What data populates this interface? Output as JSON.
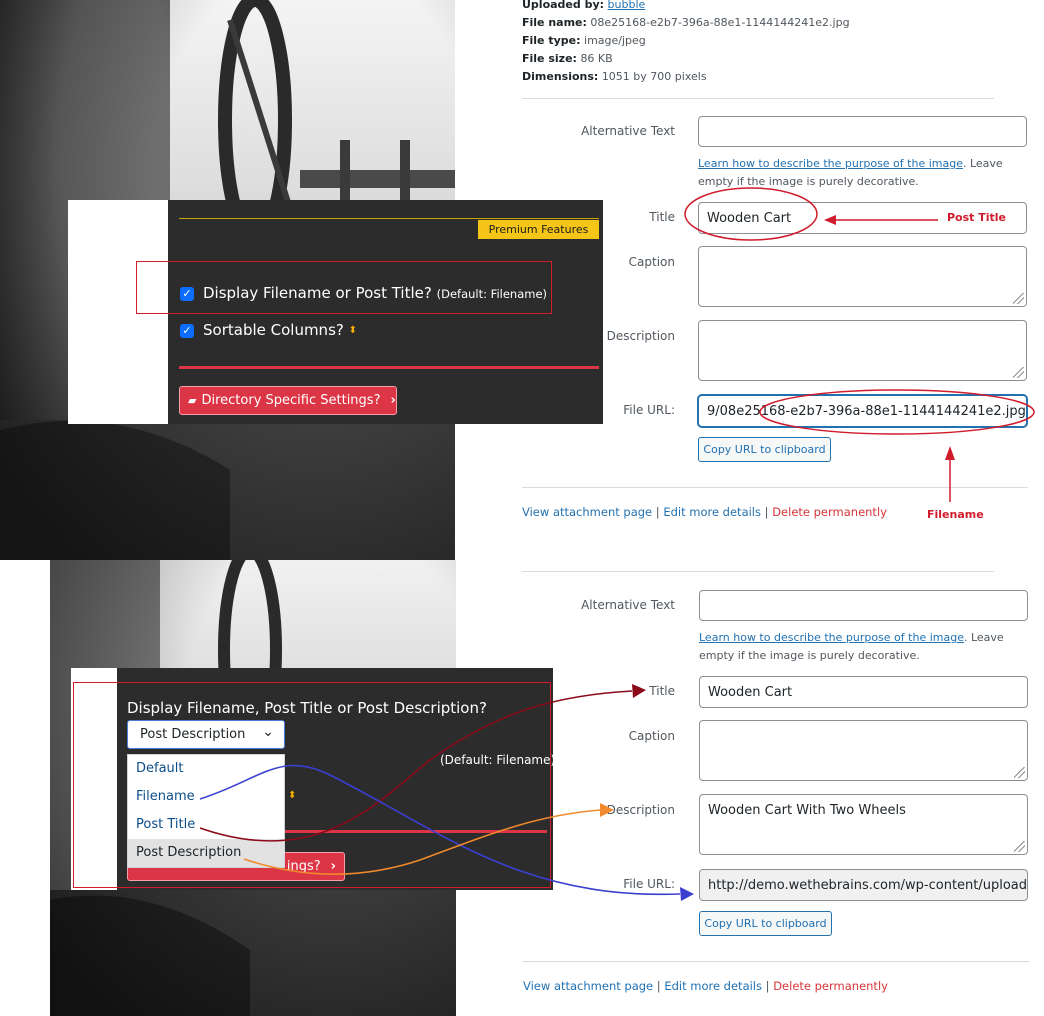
{
  "top": {
    "meta": {
      "uploaded_by_label": "Uploaded by:",
      "uploaded_by_value": "bubble",
      "file_name_label": "File name:",
      "file_name_value": "08e25168-e2b7-396a-88e1-1144144241e2.jpg",
      "file_type_label": "File type:",
      "file_type_value": "image/jpeg",
      "file_size_label": "File size:",
      "file_size_value": "86 KB",
      "dimensions_label": "Dimensions:",
      "dimensions_value": "1051 by 700 pixels"
    },
    "fields": {
      "alt_label": "Alternative Text",
      "alt_value": "",
      "help_link": "Learn how to describe the purpose of the image",
      "help_rest": ". Leave empty if the image is purely decorative.",
      "title_label": "Title",
      "title_value": "Wooden Cart",
      "caption_label": "Caption",
      "caption_value": "",
      "description_label": "Description",
      "description_value": "",
      "url_label": "File URL:",
      "url_value": "9/08e25168-e2b7-396a-88e1-1144144241e2.jpg",
      "copy_button": "Copy URL to clipboard"
    },
    "actions": {
      "view": "View attachment page",
      "edit": "Edit more details",
      "delete": "Delete permanently",
      "separator": "|"
    },
    "annotations": {
      "post_title": "Post Title",
      "filename": "Filename"
    },
    "plugin": {
      "premium_badge": "Premium Features",
      "option1_label": "Display Filename or Post Title?",
      "option1_default": "(Default: Filename)",
      "option2_label": "Sortable Columns?",
      "dir_button": "Directory Specific Settings?"
    }
  },
  "bottom": {
    "fields": {
      "alt_label": "Alternative Text",
      "alt_value": "",
      "help_link": "Learn how to describe the purpose of the image",
      "help_rest": ". Leave empty if the image is purely decorative.",
      "title_label": "Title",
      "title_value": "Wooden Cart",
      "caption_label": "Caption",
      "caption_value": "",
      "description_label": "Description",
      "description_value": "Wooden Cart With Two Wheels",
      "url_label": "File URL:",
      "url_value": "http://demo.wethebrains.com/wp-content/uploads/",
      "copy_button": "Copy URL to clipboard"
    },
    "actions": {
      "view": "View attachment page",
      "edit": "Edit more details",
      "delete": "Delete permanently",
      "separator": "|"
    },
    "plugin": {
      "question": "Display Filename, Post Title or Post Description?",
      "select_value": "Post Description",
      "default_note": "(Default: Filename)",
      "options": [
        "Default",
        "Filename",
        "Post Title",
        "Post Description"
      ],
      "hidden_button_tail": "ings?"
    }
  },
  "colors": {
    "wp_link": "#2271b1",
    "delete_red": "#d63638",
    "annotation_red": "#d01c2c",
    "premium_yellow": "#f5c518",
    "arrow_darkred": "#8b0a1a",
    "arrow_blue": "#3b3fcf",
    "arrow_orange": "#f08a2c"
  },
  "icons": [
    "checkbox-checked-icon",
    "sort-icon",
    "folder-plus-icon",
    "chevron-right-icon",
    "chevron-down-icon",
    "resize-grip-icon"
  ]
}
